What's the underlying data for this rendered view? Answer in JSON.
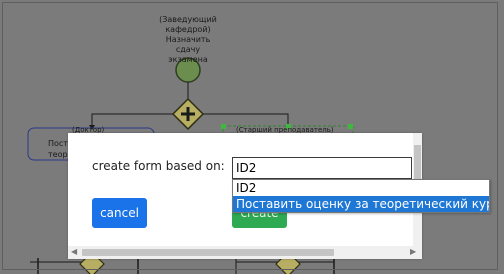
{
  "diagram": {
    "start_event_label": "(Заведующий\nкафедрой)\nНазначить\nсдачу\nэкзамена",
    "task_left_label": "(Доктор)",
    "task_left_text": "Пост\nтеор",
    "task_right_label": "(Старший преподаватель)"
  },
  "dialog": {
    "form_label": "create form based on:",
    "input_value": "ID2",
    "cancel_label": "cancel",
    "create_label": "create"
  },
  "dropdown": {
    "options": [
      "ID2",
      "Поставить оценку за теоретический курс"
    ],
    "selected_index": 1
  }
}
